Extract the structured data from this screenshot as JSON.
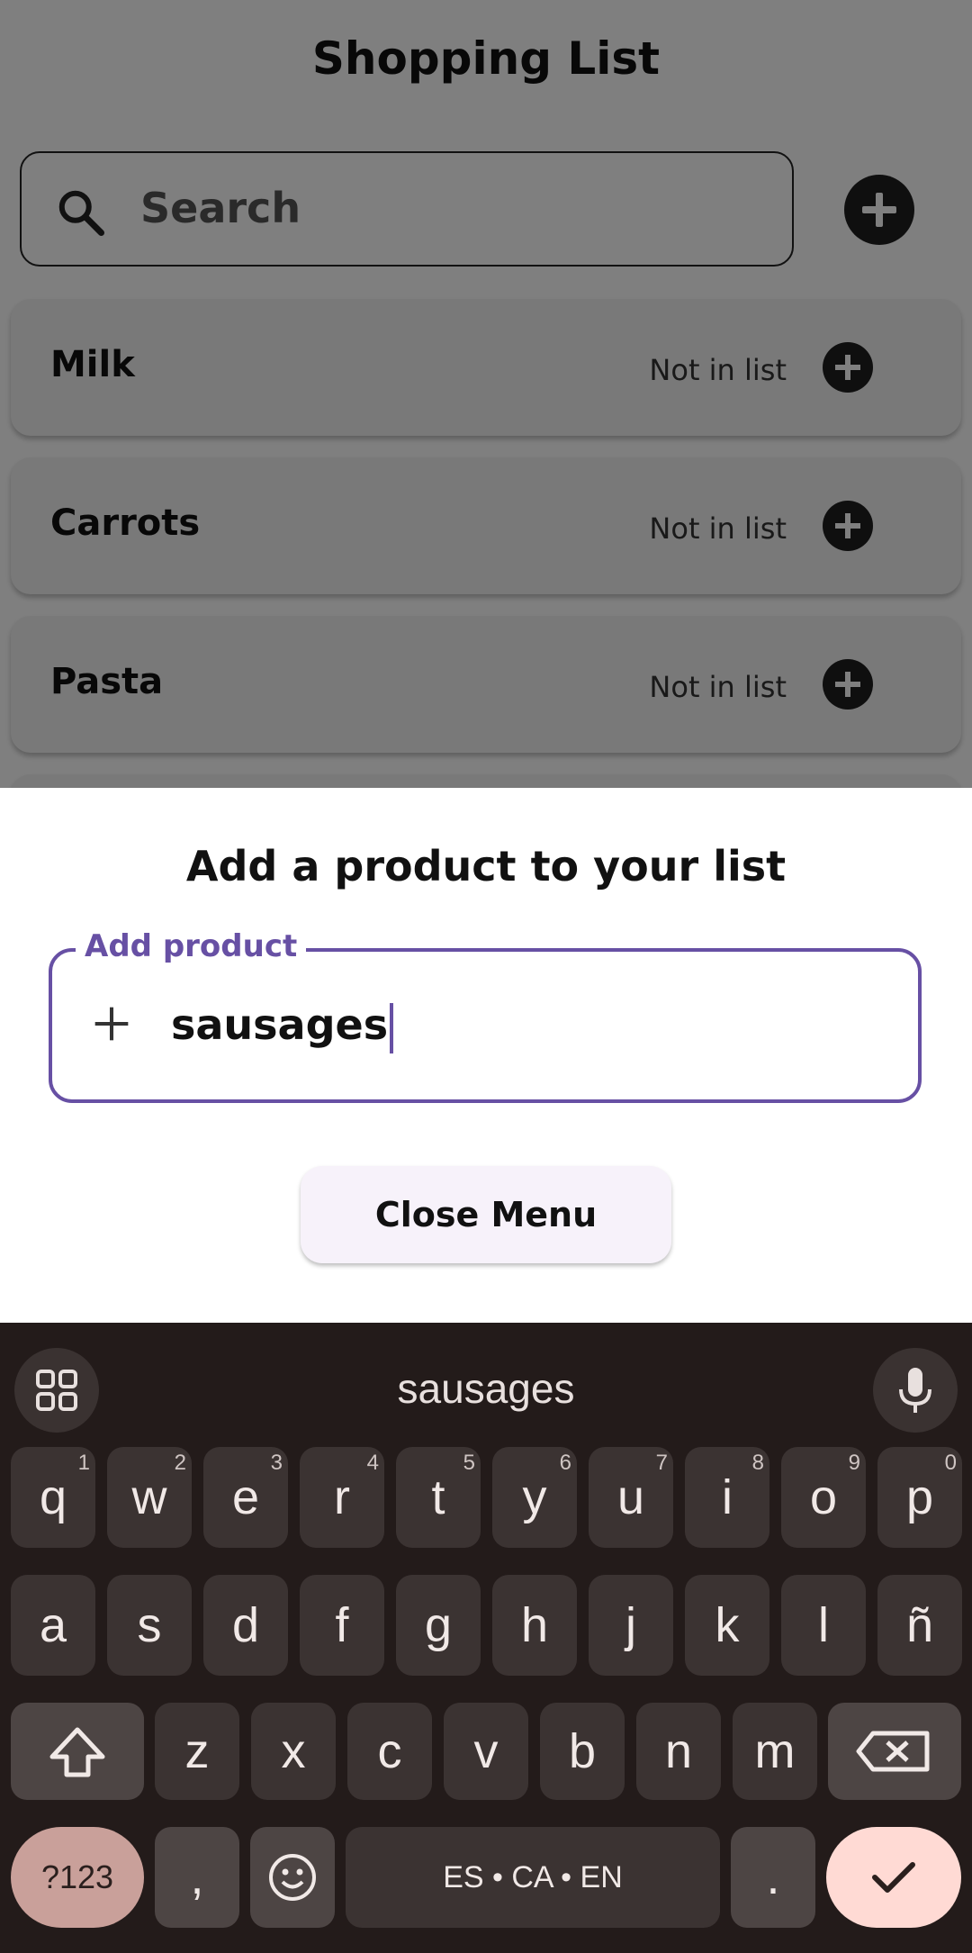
{
  "app": {
    "title": "Shopping List"
  },
  "search": {
    "placeholder": "Search"
  },
  "products": [
    {
      "name": "Milk",
      "status": "Not in list"
    },
    {
      "name": "Carrots",
      "status": "Not in list"
    },
    {
      "name": "Pasta",
      "status": "Not in list"
    }
  ],
  "sheet": {
    "title": "Add a product to your list",
    "field_label": "Add product",
    "field_value": "sausages",
    "close_label": "Close Menu"
  },
  "keyboard": {
    "suggestion": "sausages",
    "row1": [
      {
        "k": "q",
        "h": "1"
      },
      {
        "k": "w",
        "h": "2"
      },
      {
        "k": "e",
        "h": "3"
      },
      {
        "k": "r",
        "h": "4"
      },
      {
        "k": "t",
        "h": "5"
      },
      {
        "k": "y",
        "h": "6"
      },
      {
        "k": "u",
        "h": "7"
      },
      {
        "k": "i",
        "h": "8"
      },
      {
        "k": "o",
        "h": "9"
      },
      {
        "k": "p",
        "h": "0"
      }
    ],
    "row2": [
      "a",
      "s",
      "d",
      "f",
      "g",
      "h",
      "j",
      "k",
      "l",
      "ñ"
    ],
    "row3": [
      "z",
      "x",
      "c",
      "v",
      "b",
      "n",
      "m"
    ],
    "symbols_label": "?123",
    "comma_label": ",",
    "space_label": "ES • CA • EN",
    "period_label": "."
  },
  "colors": {
    "accent": "#6750a4",
    "keyboard_bg": "#231b1a",
    "enter_key": "#ffdad4"
  }
}
